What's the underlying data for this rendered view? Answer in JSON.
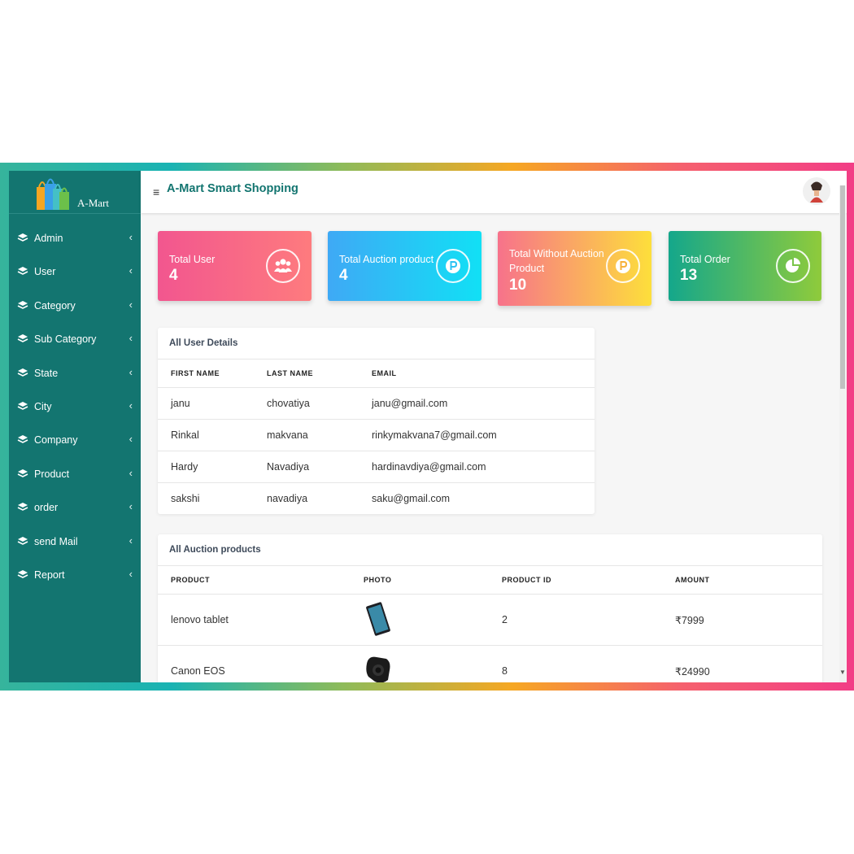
{
  "app": {
    "brand_name": "A-Mart",
    "title": "A-Mart Smart Shopping",
    "hamburger": "≡"
  },
  "sidebar": {
    "items": [
      {
        "label": "Admin"
      },
      {
        "label": "User"
      },
      {
        "label": "Category"
      },
      {
        "label": "Sub Category"
      },
      {
        "label": "State"
      },
      {
        "label": "City"
      },
      {
        "label": "Company"
      },
      {
        "label": "Product"
      },
      {
        "label": "order"
      },
      {
        "label": "send Mail"
      },
      {
        "label": "Report"
      }
    ],
    "chevron": "‹"
  },
  "stats": [
    {
      "label": "Total User",
      "value": "4",
      "icon": "users-icon"
    },
    {
      "label": "Total Auction product",
      "value": "4",
      "icon": "p-coin-icon"
    },
    {
      "label": "Total Without Auction Product",
      "value": "10",
      "icon": "p-coin-icon"
    },
    {
      "label": "Total Order",
      "value": "13",
      "icon": "pie-chart-icon"
    }
  ],
  "users_table": {
    "title": "All User Details",
    "columns": [
      "FIRST NAME",
      "LAST NAME",
      "EMAIL"
    ],
    "rows": [
      [
        "janu",
        "chovatiya",
        "janu@gmail.com"
      ],
      [
        "Rinkal",
        "makvana",
        "rinkymakvana7@gmail.com"
      ],
      [
        "Hardy",
        "Navadiya",
        "hardinavdiya@gmail.com"
      ],
      [
        "sakshi",
        "navadiya",
        "saku@gmail.com"
      ]
    ]
  },
  "auction_table": {
    "title": "All Auction products",
    "columns": [
      "PRODUCT",
      "PHOTO",
      "PRODUCT ID",
      "AMOUNT"
    ],
    "rows": [
      {
        "product": "lenovo tablet",
        "photo": "tablet-photo",
        "id": "2",
        "amount": "₹7999"
      },
      {
        "product": "Canon EOS",
        "photo": "camera-photo",
        "id": "8",
        "amount": "₹24990"
      }
    ]
  },
  "colors": {
    "sidebar": "#137570",
    "card_user": [
      "#f2568f",
      "#fe7b7e"
    ],
    "card_auction": [
      "#3fa9f5",
      "#11e0f5"
    ],
    "card_without": [
      "#f7728b",
      "#fddf3b"
    ],
    "card_order": [
      "#14a78b",
      "#8fcb3b"
    ]
  }
}
